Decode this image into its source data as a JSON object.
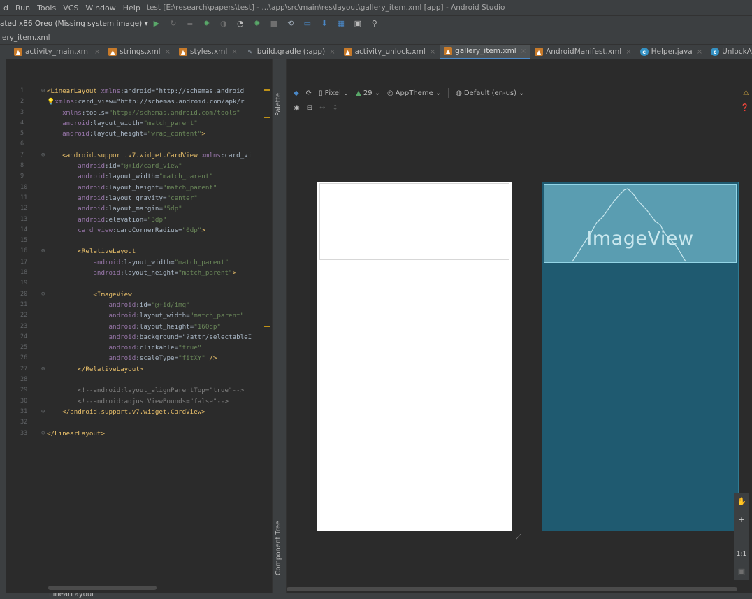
{
  "menu": {
    "items": [
      "d",
      "Run",
      "Tools",
      "VCS",
      "Window",
      "Help"
    ],
    "window_title": "test [E:\\research\\papers\\test] - ...\\app\\src\\main\\res\\layout\\gallery_item.xml [app] - Android Studio"
  },
  "toolbar": {
    "device_config": "ated x86 Oreo (Missing system image) ▾",
    "icons": [
      "run-icon",
      "apply-changes-icon",
      "debug-icon",
      "profile-icon",
      "attach-icon",
      "sync-icon",
      "avd-icon",
      "sdk-icon",
      "structure-icon",
      "search-icon"
    ]
  },
  "breadcrumb": {
    "file": "lery_item.xml"
  },
  "tabs": [
    {
      "label": "activity_main.xml",
      "icon": "xml",
      "active": false
    },
    {
      "label": "strings.xml",
      "icon": "xml",
      "active": false
    },
    {
      "label": "styles.xml",
      "icon": "xml",
      "active": false
    },
    {
      "label": "build.gradle (:app)",
      "icon": "gradle",
      "active": false
    },
    {
      "label": "activity_unlock.xml",
      "icon": "xml",
      "active": false
    },
    {
      "label": "gallery_item.xml",
      "icon": "xml",
      "active": true
    },
    {
      "label": "AndroidManifest.xml",
      "icon": "xml",
      "active": false
    },
    {
      "label": "Helper.java",
      "icon": "java",
      "active": false
    },
    {
      "label": "UnlockAdapter.java",
      "icon": "java",
      "active": false
    }
  ],
  "editor": {
    "line_numbers": [
      "1",
      "2",
      "3",
      "4",
      "5",
      "6",
      "7",
      "8",
      "9",
      "10",
      "11",
      "12",
      "13",
      "14",
      "15",
      "16",
      "17",
      "18",
      "19",
      "20",
      "21",
      "22",
      "23",
      "24",
      "25",
      "26",
      "27",
      "28",
      "29",
      "30",
      "31",
      "32",
      "33"
    ],
    "lines": [
      "<LinearLayout xmlns:android=\"http://schemas.android",
      "  xmlns:card_view=\"http://schemas.android.com/apk/r",
      "    xmlns:tools=\"http://schemas.android.com/tools\"",
      "    android:layout_width=\"match_parent\"",
      "    android:layout_height=\"wrap_content\">",
      "",
      "    <android.support.v7.widget.CardView xmlns:card_vi",
      "        android:id=\"@+id/card_view\"",
      "        android:layout_width=\"match_parent\"",
      "        android:layout_height=\"match_parent\"",
      "        android:layout_gravity=\"center\"",
      "        android:layout_margin=\"5dp\"",
      "        android:elevation=\"3dp\"",
      "        card_view:cardCornerRadius=\"0dp\">",
      "",
      "        <RelativeLayout",
      "            android:layout_width=\"match_parent\"",
      "            android:layout_height=\"match_parent\">",
      "",
      "            <ImageView",
      "                android:id=\"@+id/img\"",
      "                android:layout_width=\"match_parent\"",
      "                android:layout_height=\"160dp\"",
      "                android:background=\"?attr/selectableI",
      "                android:clickable=\"true\"",
      "                android:scaleType=\"fitXY\" />",
      "        </RelativeLayout>",
      "",
      "        <!--android:layout_alignParentTop=\"true\"-->",
      "        <!--android:adjustViewBounds=\"false\"-->",
      "    </android.support.v7.widget.CardView>",
      "",
      "</LinearLayout>"
    ]
  },
  "side_strip": {
    "palette": "Palette",
    "component_tree": "Component Tree"
  },
  "design_toolbar": {
    "device": "Pixel",
    "api": "29",
    "theme": "AppTheme",
    "locale": "Default (en-us)"
  },
  "blueprint": {
    "imageview_label": "ImageView"
  },
  "zoom": {
    "plus": "+",
    "minus": "−",
    "one_to_one": "1:1"
  },
  "status": {
    "component": "LinearLayout"
  },
  "colors": {
    "accent": "#4a88c7",
    "blueprint_bg": "#1f5a70",
    "imageview_bg": "#5a9db1"
  }
}
